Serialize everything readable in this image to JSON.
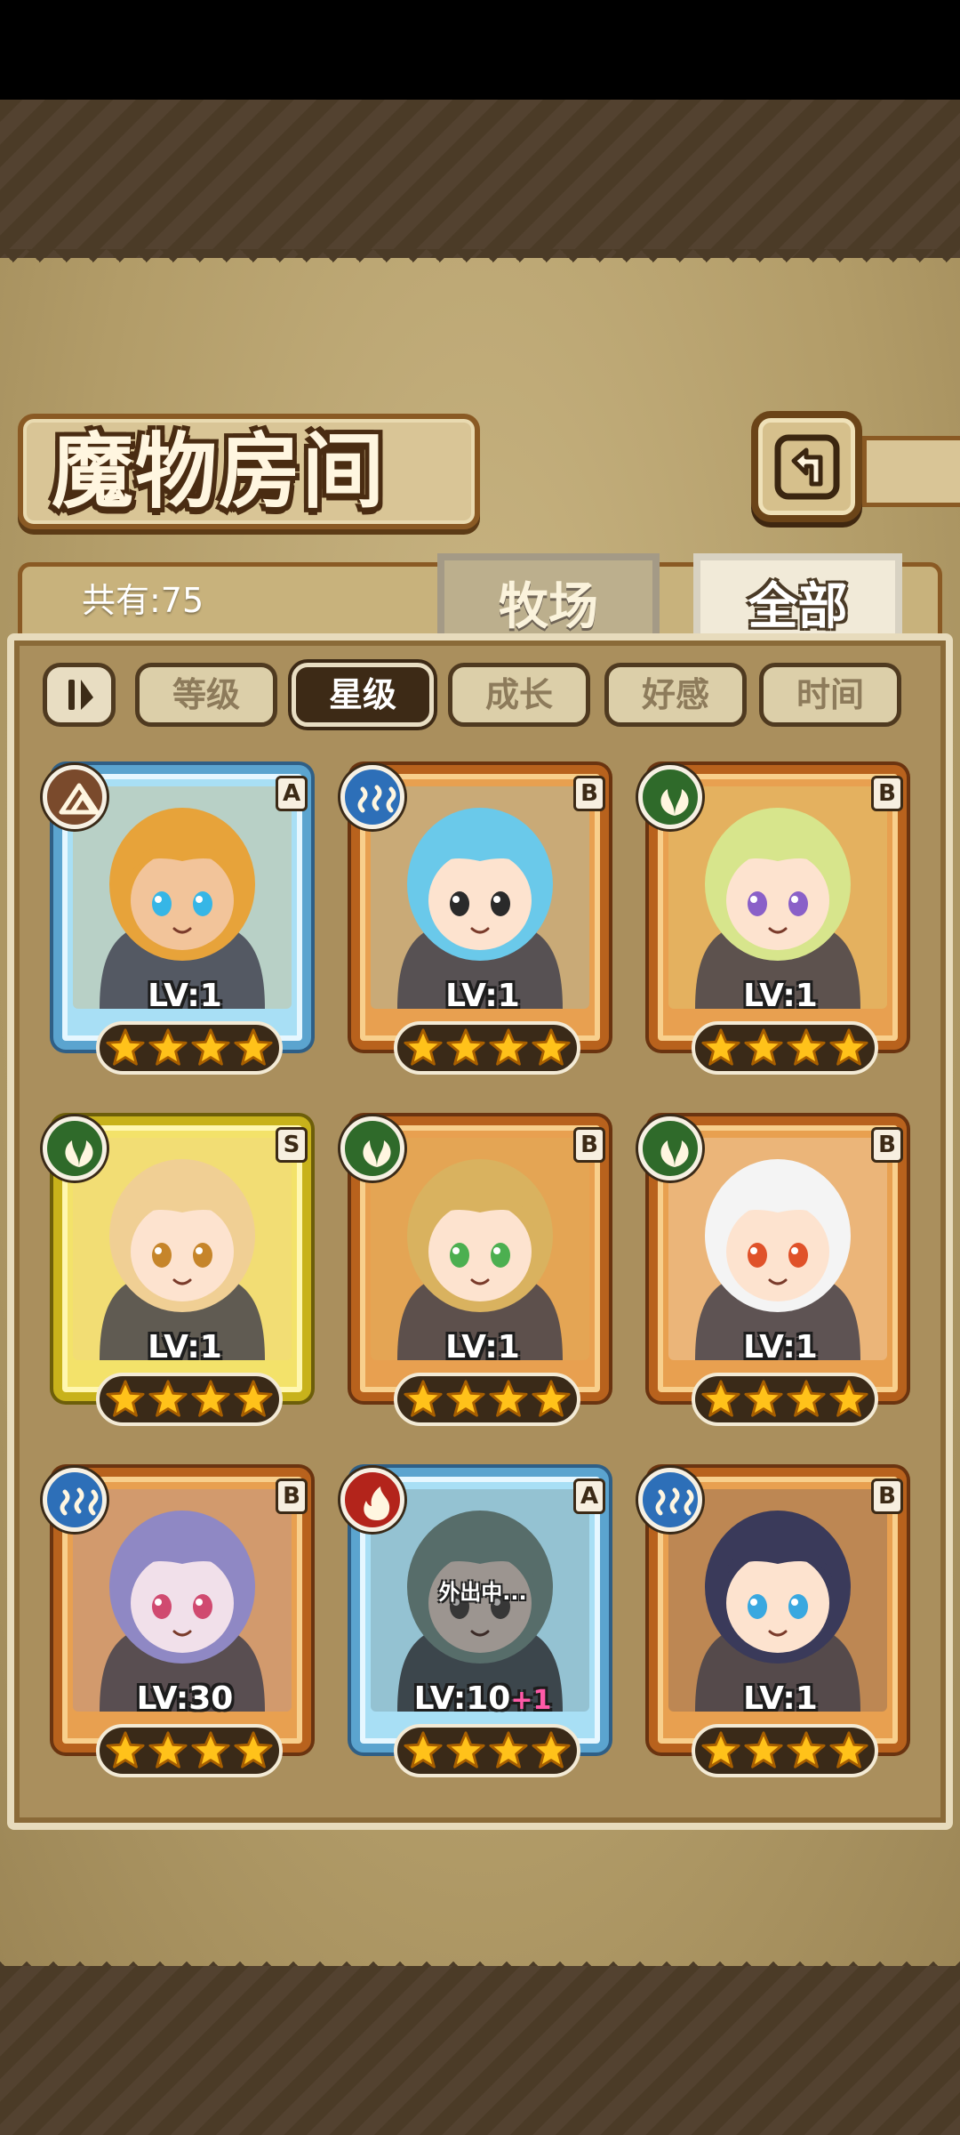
{
  "header": {
    "title": "魔物房间",
    "count": "共有:75"
  },
  "tabs": [
    {
      "label": "牧场",
      "selected": false
    },
    {
      "label": "全部",
      "selected": true
    }
  ],
  "sort": {
    "toggle_label": "⇅",
    "options": [
      {
        "label": "等级",
        "active": false
      },
      {
        "label": "星级",
        "active": true
      },
      {
        "label": "成长",
        "active": false
      },
      {
        "label": "好感",
        "active": false
      },
      {
        "label": "时间",
        "active": false
      }
    ]
  },
  "monsters": [
    {
      "element": "earth-icon",
      "rank": "A",
      "frame": "blue",
      "level": "LV:1",
      "stars": 4,
      "skin": "#f2c49a",
      "hair": "#e7a33a",
      "eye": "#36b6e6",
      "status": ""
    },
    {
      "element": "water-icon",
      "rank": "B",
      "frame": "orange",
      "level": "LV:1",
      "stars": 4,
      "skin": "#fde3cf",
      "hair": "#6ac9ea",
      "eye": "#2a2a2a",
      "status": ""
    },
    {
      "element": "wood-icon",
      "rank": "B",
      "frame": "orange",
      "level": "LV:1",
      "stars": 4,
      "skin": "#fde3cf",
      "hair": "#d7e58c",
      "eye": "#8a60c8",
      "status": ""
    },
    {
      "element": "wood-icon",
      "rank": "S",
      "frame": "gold",
      "level": "LV:1",
      "stars": 4,
      "skin": "#fde3cf",
      "hair": "#f0cf94",
      "eye": "#c6852a",
      "status": ""
    },
    {
      "element": "wood-icon",
      "rank": "B",
      "frame": "orange",
      "level": "LV:1",
      "stars": 4,
      "skin": "#fde3cf",
      "hair": "#d9b25f",
      "eye": "#4caf50",
      "status": ""
    },
    {
      "element": "wood-icon",
      "rank": "B",
      "frame": "orange",
      "level": "LV:1",
      "stars": 4,
      "skin": "#fde3cf",
      "hair": "#f4f4f4",
      "eye": "#e0522a",
      "status": ""
    },
    {
      "element": "water-icon",
      "rank": "B",
      "frame": "orange",
      "level": "LV:30",
      "stars": 4,
      "skin": "#f1e0ea",
      "hair": "#8f88c4",
      "eye": "#d04a70",
      "status": ""
    },
    {
      "element": "fire-icon",
      "rank": "A",
      "frame": "blue",
      "level": "LV:10",
      "level_bonus": "+1",
      "stars": 4,
      "skin": "#fde3cf",
      "hair": "#5fb3a8",
      "eye": "#555555",
      "status": "外出中..."
    },
    {
      "element": "water-icon",
      "rank": "B",
      "frame": "orange",
      "level": "LV:1",
      "stars": 4,
      "skin": "#fde3cf",
      "hair": "#3a3a5a",
      "eye": "#39a8e0",
      "status": ""
    }
  ],
  "colors": {
    "star": "#ffc21a",
    "star_outline": "#a85f00"
  }
}
